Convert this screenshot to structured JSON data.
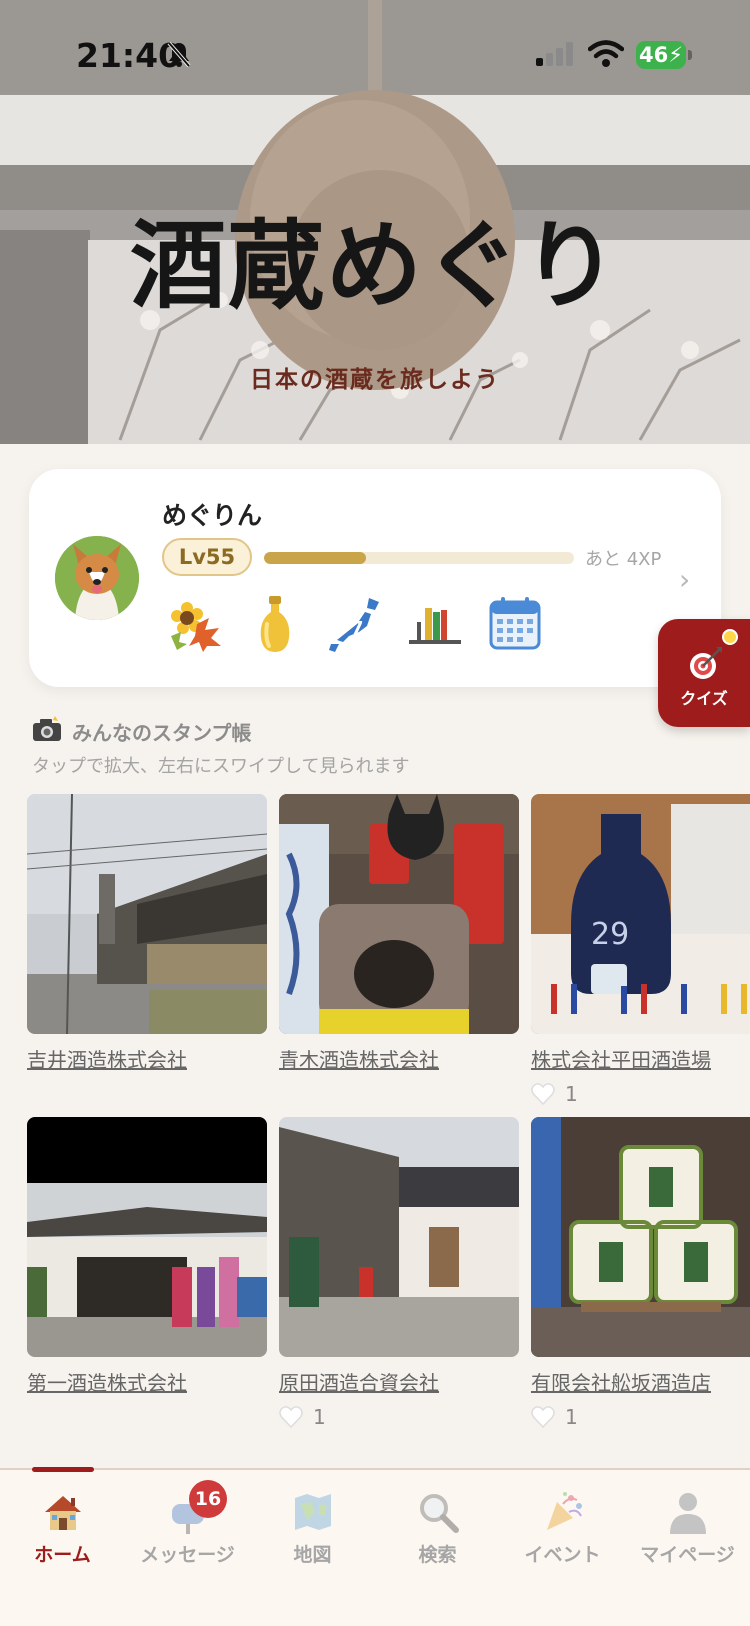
{
  "status_bar": {
    "time": "21:40",
    "battery": "46"
  },
  "hero": {
    "title": "酒蔵めぐり",
    "subtitle": "日本の酒蔵を旅しよう"
  },
  "profile": {
    "name": "めぐりん",
    "level": "Lv55",
    "xp_progress": 0.33,
    "xp_remaining": "あと 4XP",
    "badges": [
      "sunflower-maple-badge-icon",
      "sake-bottle-badge-icon",
      "japan-map-badge-icon",
      "bookshelf-badge-icon",
      "calendar-badge-icon"
    ]
  },
  "quiz": {
    "label": "クイズ"
  },
  "stamps": {
    "title": "みんなのスタンプ帳",
    "hint": "タップで拡大、左右にスワイプして見られます",
    "items": [
      {
        "name": "吉井酒造株式会社",
        "likes": ""
      },
      {
        "name": "青木酒造株式会社",
        "likes": ""
      },
      {
        "name": "株式会社平田酒造場",
        "likes": "1"
      },
      {
        "name": "第一酒造株式会社",
        "likes": ""
      },
      {
        "name": "原田酒造合資会社",
        "likes": "1"
      },
      {
        "name": "有限会社舩坂酒造店",
        "likes": "1"
      }
    ]
  },
  "nav": {
    "items": [
      {
        "label": "ホーム",
        "icon": "house-icon",
        "active": true
      },
      {
        "label": "メッセージ",
        "icon": "mailbox-icon",
        "badge": "16"
      },
      {
        "label": "地図",
        "icon": "map-icon"
      },
      {
        "label": "検索",
        "icon": "magnifier-icon"
      },
      {
        "label": "イベント",
        "icon": "party-popper-icon"
      },
      {
        "label": "マイページ",
        "icon": "person-icon"
      }
    ]
  },
  "colors": {
    "accent": "#9e1c1c",
    "gold": "#c9a448",
    "background": "#f6f2ed"
  }
}
